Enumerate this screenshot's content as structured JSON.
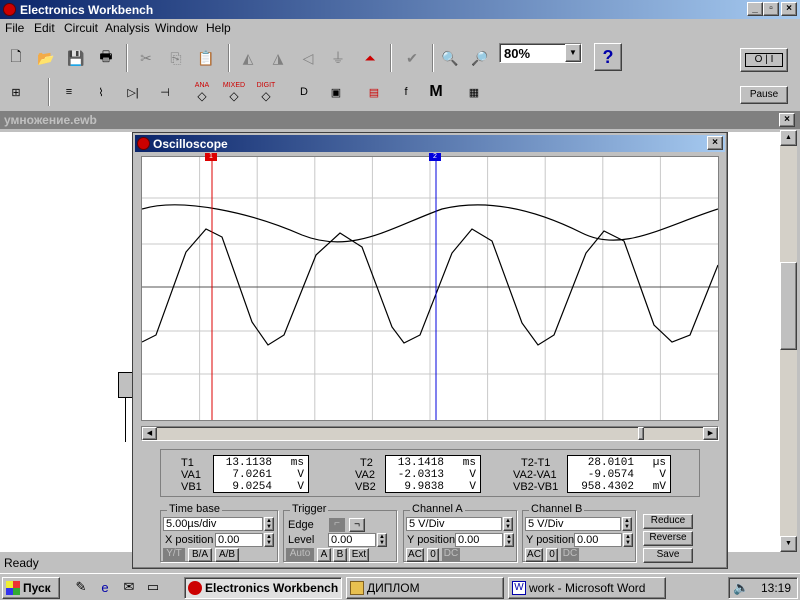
{
  "window": {
    "title": "Electronics Workbench",
    "min": "_",
    "max": "▫",
    "close": "×"
  },
  "menu": [
    "File",
    "Edit",
    "Circuit",
    "Analysis",
    "Window",
    "Help"
  ],
  "toolbar": {
    "zoom": "80%",
    "help": "?",
    "pause": "Pause",
    "ana": "ANA",
    "mixed": "MIXED",
    "digit": "DIGIT",
    "m": "M"
  },
  "document": {
    "title": "умножение.ewb"
  },
  "scope": {
    "title": "Oscilloscope",
    "t1": {
      "label": "T1",
      "value": "13.1138",
      "unit": "ms"
    },
    "va1": {
      "label": "VA1",
      "value": "7.0261",
      "unit": "V"
    },
    "vb1": {
      "label": "VB1",
      "value": "9.0254",
      "unit": "V"
    },
    "t2": {
      "label": "T2",
      "value": "13.1418",
      "unit": "ms"
    },
    "va2": {
      "label": "VA2",
      "value": "-2.0313",
      "unit": "V"
    },
    "vb2": {
      "label": "VB2",
      "value": "9.9838",
      "unit": "V"
    },
    "dt": {
      "label": "T2-T1",
      "value": "28.0101",
      "unit": "µs"
    },
    "dva": {
      "label": "VA2-VA1",
      "value": "-9.0574",
      "unit": "V"
    },
    "dvb": {
      "label": "VB2-VB1",
      "value": "958.4302",
      "unit": "mV"
    },
    "timebase": {
      "title": "Time base",
      "value": "5.00µs/div",
      "xpos_label": "X position",
      "xpos": "0.00",
      "modes": [
        "Y/T",
        "B/A",
        "A/B"
      ]
    },
    "trigger": {
      "title": "Trigger",
      "edge": "Edge",
      "level_label": "Level",
      "level": "0.00",
      "modes": [
        "Auto",
        "A",
        "B",
        "Ext"
      ]
    },
    "channel_a": {
      "title": "Channel A",
      "value": "5 V/Div",
      "ypos_label": "Y position",
      "ypos": "0.00",
      "coupling": [
        "AC",
        "0",
        "DC"
      ]
    },
    "channel_b": {
      "title": "Channel B",
      "value": "5 V/Div",
      "ypos_label": "Y position",
      "ypos": "0.00",
      "coupling": [
        "AC",
        "0",
        "DC"
      ]
    },
    "buttons": [
      "Reduce",
      "Reverse",
      "Save"
    ],
    "cursor1": "1",
    "cursor2": "2"
  },
  "status": "Ready",
  "taskbar": {
    "start": "Пуск",
    "tasks": [
      "Electronics Workbench",
      "ДИПЛОМ",
      "work - Microsoft Word"
    ],
    "clock": "13:19"
  }
}
